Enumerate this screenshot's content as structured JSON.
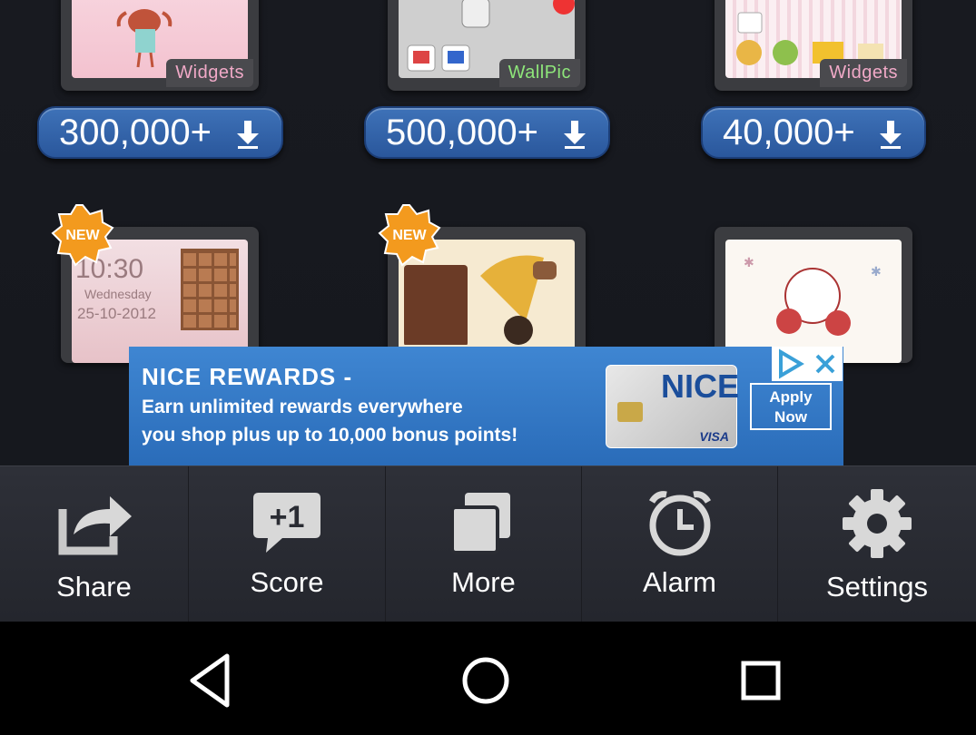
{
  "items_row1": [
    {
      "tag": "Widgets",
      "downloads": "300,000+"
    },
    {
      "tag": "WallPic",
      "downloads": "500,000+"
    },
    {
      "tag": "Widgets",
      "downloads": "40,000+"
    }
  ],
  "items_row2": [
    {
      "badge": "NEW",
      "clock_time": "10:30",
      "clock_day": "Wednesday",
      "clock_date": "25-10-2012"
    },
    {
      "badge": "NEW"
    },
    {}
  ],
  "ad": {
    "headline": "NICE REWARDS -",
    "line1": "Earn unlimited rewards everywhere",
    "line2": "you shop plus up to 10,000 bonus points!",
    "card_brand": "NICE",
    "card_network": "VISA",
    "cta_line1": "Apply",
    "cta_line2": "Now"
  },
  "menu": [
    {
      "label": "Share",
      "icon": "share-icon"
    },
    {
      "label": "Score",
      "icon": "plus-one-score-icon"
    },
    {
      "label": "More",
      "icon": "more-apps-icon"
    },
    {
      "label": "Alarm",
      "icon": "alarm-clock-icon"
    },
    {
      "label": "Settings",
      "icon": "gear-icon"
    }
  ],
  "colors": {
    "button_blue": "#2f5ea6",
    "tag_pink": "#f0a9c7",
    "tag_green": "#8ee67a",
    "badge_orange": "#f39a1e"
  }
}
